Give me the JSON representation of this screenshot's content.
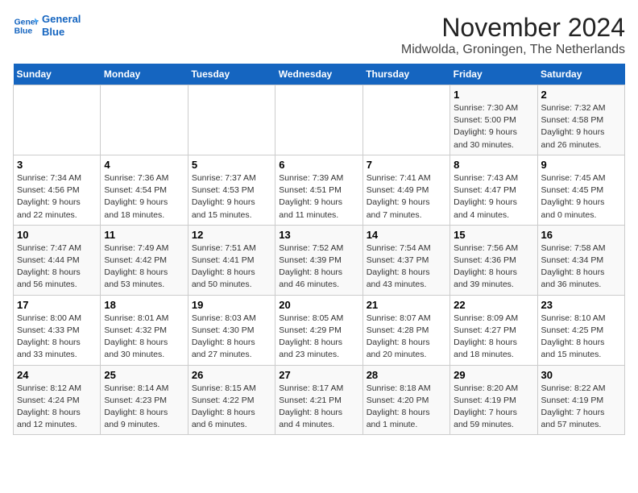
{
  "logo": {
    "line1": "General",
    "line2": "Blue"
  },
  "title": "November 2024",
  "subtitle": "Midwolda, Groningen, The Netherlands",
  "weekdays": [
    "Sunday",
    "Monday",
    "Tuesday",
    "Wednesday",
    "Thursday",
    "Friday",
    "Saturday"
  ],
  "weeks": [
    [
      {
        "day": "",
        "detail": ""
      },
      {
        "day": "",
        "detail": ""
      },
      {
        "day": "",
        "detail": ""
      },
      {
        "day": "",
        "detail": ""
      },
      {
        "day": "",
        "detail": ""
      },
      {
        "day": "1",
        "detail": "Sunrise: 7:30 AM\nSunset: 5:00 PM\nDaylight: 9 hours\nand 30 minutes."
      },
      {
        "day": "2",
        "detail": "Sunrise: 7:32 AM\nSunset: 4:58 PM\nDaylight: 9 hours\nand 26 minutes."
      }
    ],
    [
      {
        "day": "3",
        "detail": "Sunrise: 7:34 AM\nSunset: 4:56 PM\nDaylight: 9 hours\nand 22 minutes."
      },
      {
        "day": "4",
        "detail": "Sunrise: 7:36 AM\nSunset: 4:54 PM\nDaylight: 9 hours\nand 18 minutes."
      },
      {
        "day": "5",
        "detail": "Sunrise: 7:37 AM\nSunset: 4:53 PM\nDaylight: 9 hours\nand 15 minutes."
      },
      {
        "day": "6",
        "detail": "Sunrise: 7:39 AM\nSunset: 4:51 PM\nDaylight: 9 hours\nand 11 minutes."
      },
      {
        "day": "7",
        "detail": "Sunrise: 7:41 AM\nSunset: 4:49 PM\nDaylight: 9 hours\nand 7 minutes."
      },
      {
        "day": "8",
        "detail": "Sunrise: 7:43 AM\nSunset: 4:47 PM\nDaylight: 9 hours\nand 4 minutes."
      },
      {
        "day": "9",
        "detail": "Sunrise: 7:45 AM\nSunset: 4:45 PM\nDaylight: 9 hours\nand 0 minutes."
      }
    ],
    [
      {
        "day": "10",
        "detail": "Sunrise: 7:47 AM\nSunset: 4:44 PM\nDaylight: 8 hours\nand 56 minutes."
      },
      {
        "day": "11",
        "detail": "Sunrise: 7:49 AM\nSunset: 4:42 PM\nDaylight: 8 hours\nand 53 minutes."
      },
      {
        "day": "12",
        "detail": "Sunrise: 7:51 AM\nSunset: 4:41 PM\nDaylight: 8 hours\nand 50 minutes."
      },
      {
        "day": "13",
        "detail": "Sunrise: 7:52 AM\nSunset: 4:39 PM\nDaylight: 8 hours\nand 46 minutes."
      },
      {
        "day": "14",
        "detail": "Sunrise: 7:54 AM\nSunset: 4:37 PM\nDaylight: 8 hours\nand 43 minutes."
      },
      {
        "day": "15",
        "detail": "Sunrise: 7:56 AM\nSunset: 4:36 PM\nDaylight: 8 hours\nand 39 minutes."
      },
      {
        "day": "16",
        "detail": "Sunrise: 7:58 AM\nSunset: 4:34 PM\nDaylight: 8 hours\nand 36 minutes."
      }
    ],
    [
      {
        "day": "17",
        "detail": "Sunrise: 8:00 AM\nSunset: 4:33 PM\nDaylight: 8 hours\nand 33 minutes."
      },
      {
        "day": "18",
        "detail": "Sunrise: 8:01 AM\nSunset: 4:32 PM\nDaylight: 8 hours\nand 30 minutes."
      },
      {
        "day": "19",
        "detail": "Sunrise: 8:03 AM\nSunset: 4:30 PM\nDaylight: 8 hours\nand 27 minutes."
      },
      {
        "day": "20",
        "detail": "Sunrise: 8:05 AM\nSunset: 4:29 PM\nDaylight: 8 hours\nand 23 minutes."
      },
      {
        "day": "21",
        "detail": "Sunrise: 8:07 AM\nSunset: 4:28 PM\nDaylight: 8 hours\nand 20 minutes."
      },
      {
        "day": "22",
        "detail": "Sunrise: 8:09 AM\nSunset: 4:27 PM\nDaylight: 8 hours\nand 18 minutes."
      },
      {
        "day": "23",
        "detail": "Sunrise: 8:10 AM\nSunset: 4:25 PM\nDaylight: 8 hours\nand 15 minutes."
      }
    ],
    [
      {
        "day": "24",
        "detail": "Sunrise: 8:12 AM\nSunset: 4:24 PM\nDaylight: 8 hours\nand 12 minutes."
      },
      {
        "day": "25",
        "detail": "Sunrise: 8:14 AM\nSunset: 4:23 PM\nDaylight: 8 hours\nand 9 minutes."
      },
      {
        "day": "26",
        "detail": "Sunrise: 8:15 AM\nSunset: 4:22 PM\nDaylight: 8 hours\nand 6 minutes."
      },
      {
        "day": "27",
        "detail": "Sunrise: 8:17 AM\nSunset: 4:21 PM\nDaylight: 8 hours\nand 4 minutes."
      },
      {
        "day": "28",
        "detail": "Sunrise: 8:18 AM\nSunset: 4:20 PM\nDaylight: 8 hours\nand 1 minute."
      },
      {
        "day": "29",
        "detail": "Sunrise: 8:20 AM\nSunset: 4:19 PM\nDaylight: 7 hours\nand 59 minutes."
      },
      {
        "day": "30",
        "detail": "Sunrise: 8:22 AM\nSunset: 4:19 PM\nDaylight: 7 hours\nand 57 minutes."
      }
    ]
  ]
}
